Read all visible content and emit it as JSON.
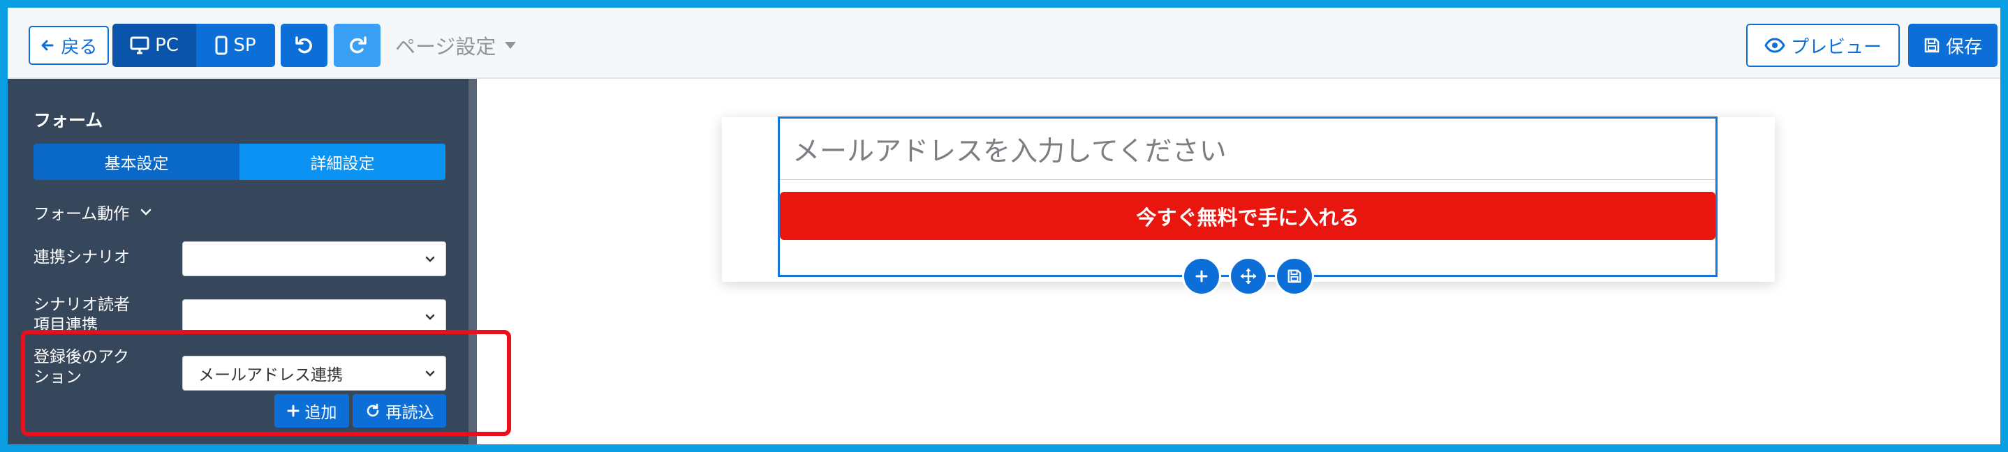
{
  "toolbar": {
    "back_label": "戻る",
    "pc_label": "PC",
    "sp_label": "SP",
    "page_settings_label": "ページ設定",
    "preview_label": "プレビュー",
    "save_label": "保存"
  },
  "sidebar": {
    "title": "フォーム",
    "tabs": [
      {
        "label": "基本設定",
        "active": true
      },
      {
        "label": "詳細設定",
        "active": false
      }
    ],
    "form_action_label": "フォーム動作",
    "fields": [
      {
        "label": "連携シナリオ",
        "value": ""
      },
      {
        "label_line1": "シナリオ読者",
        "label_line2": "項目連携",
        "value": ""
      },
      {
        "label_line1": "登録後のアク",
        "label_line2": "ション",
        "value": "メールアドレス連携"
      }
    ],
    "add_label": "追加",
    "reload_label": "再読込"
  },
  "canvas": {
    "email_placeholder": "メールアドレスを入力してください",
    "cta_label": "今すぐ無料で手に入れる"
  },
  "colors": {
    "frame_border": "#0a9ee3",
    "primary": "#0c6fd8",
    "sidebar_bg": "#36475b",
    "cta_bg": "#e8160e",
    "highlight": "#ea0f1a"
  }
}
